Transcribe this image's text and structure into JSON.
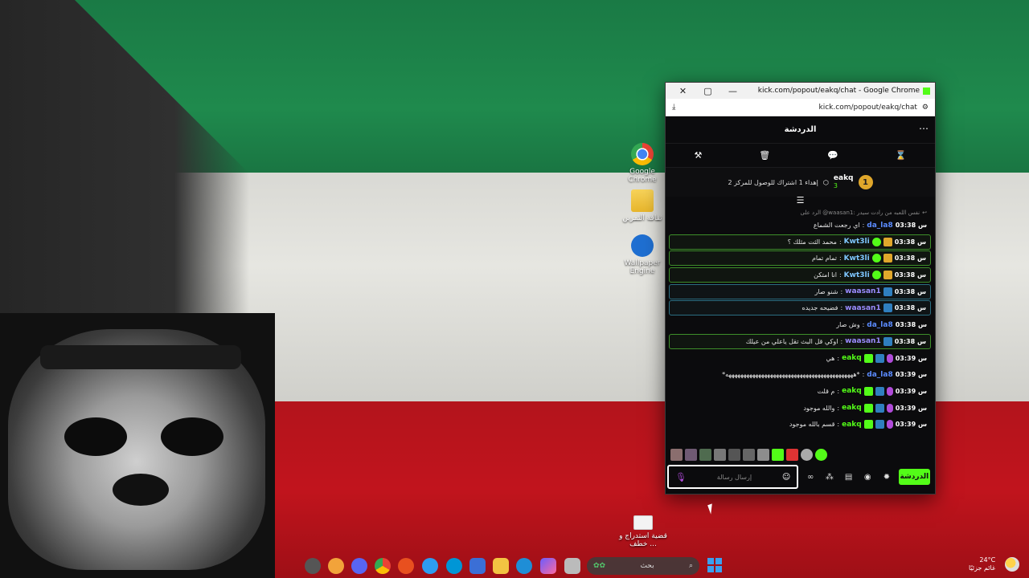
{
  "desktop": {
    "icons": [
      {
        "label": "Google Chrome",
        "icon": "chrome-icon"
      },
      {
        "label": "ثقافة التمرين",
        "icon": "folder-icon"
      },
      {
        "label": "Wallpaper Engine",
        "icon": "wallpaper-engine-icon"
      },
      {
        "label": "قضية استدراج و خطف ...",
        "icon": "document-icon"
      }
    ]
  },
  "browser": {
    "window_title": "kick.com/popout/eakq/chat - Google Chrome",
    "url": "kick.com/popout/eakq/chat",
    "controls": {
      "close": "✕",
      "maximize": "▢",
      "minimize": "—"
    }
  },
  "chat": {
    "header_title": "الدردشة",
    "more": "⋯",
    "tools": [
      "hammer-icon",
      "trash-icon",
      "chat-bubble-icon",
      "hourglass-icon"
    ],
    "pinned": {
      "rank": "1",
      "username": "eakq",
      "count": "3",
      "goal_text": "إهداء 1 اشتراك للوصول للمركز 2"
    },
    "reply_preview": "الرد على @waasan1: نفس اللعبه من رادت سيدر",
    "messages": [
      {
        "time": "س 03:38",
        "user": "da_la8",
        "text": "اي رجعت الشماع",
        "style": "plain",
        "badges": [],
        "color": "#5b8bff"
      },
      {
        "time": "س 03:38",
        "user": "Kwt3li",
        "text": "محمد الثت مثلك ؟",
        "style": "hl",
        "badges": [
          "crown",
          "verified"
        ],
        "color": "#7fc7ff"
      },
      {
        "time": "س 03:38",
        "user": "Kwt3li",
        "text": "تمام تمام",
        "style": "hl",
        "badges": [
          "crown",
          "verified"
        ],
        "color": "#7fc7ff"
      },
      {
        "time": "س 03:38",
        "user": "Kwt3li",
        "text": "انا امتكن",
        "style": "hl",
        "badges": [
          "crown",
          "verified"
        ],
        "color": "#7fc7ff"
      },
      {
        "time": "س 03:38",
        "user": "waasan1",
        "text": "شنو صار",
        "style": "hl2",
        "badges": [
          "mod"
        ],
        "color": "#9b8cff"
      },
      {
        "time": "س 03:38",
        "user": "waasan1",
        "text": "فضيحه جديده",
        "style": "hl2",
        "badges": [
          "mod"
        ],
        "color": "#9b8cff"
      },
      {
        "time": "س 03:38",
        "user": "da_la8",
        "text": "وش صار",
        "style": "plain",
        "badges": [],
        "color": "#5b8bff"
      },
      {
        "time": "س 03:38",
        "user": "waasan1",
        "text": "اوكي قل البث تقل ياعلي من عيلك",
        "style": "hl",
        "badges": [
          "mod"
        ],
        "color": "#9b8cff"
      },
      {
        "time": "س 03:39",
        "user": "eakq",
        "text": "هي",
        "style": "plain",
        "badges": [
          "mic",
          "mod",
          "sub"
        ],
        "color": "#53fc18"
      },
      {
        "time": "س 03:39",
        "user": "da_la8",
        "text": "*هههههههههههههههههههههههههههههههههههههههههههه*",
        "style": "plain",
        "badges": [],
        "color": "#5b8bff"
      },
      {
        "time": "س 03:39",
        "user": "eakq",
        "text": "م قلت",
        "style": "plain",
        "badges": [
          "mic",
          "mod",
          "sub"
        ],
        "color": "#53fc18"
      },
      {
        "time": "س 03:39",
        "user": "eakq",
        "text": "والله موجود",
        "style": "plain",
        "badges": [
          "mic",
          "mod",
          "sub"
        ],
        "color": "#53fc18"
      },
      {
        "time": "س 03:39",
        "user": "eakq",
        "text": "قسم بالله موجود",
        "style": "plain",
        "badges": [
          "mic",
          "mod",
          "sub"
        ],
        "color": "#53fc18"
      }
    ],
    "input": {
      "placeholder": "إرسال رسالة",
      "send_label": "الدردشة"
    }
  },
  "taskbar": {
    "search_placeholder": "بحث",
    "weather_temp": "24°C",
    "weather_desc": "غائم جزئيًا"
  }
}
